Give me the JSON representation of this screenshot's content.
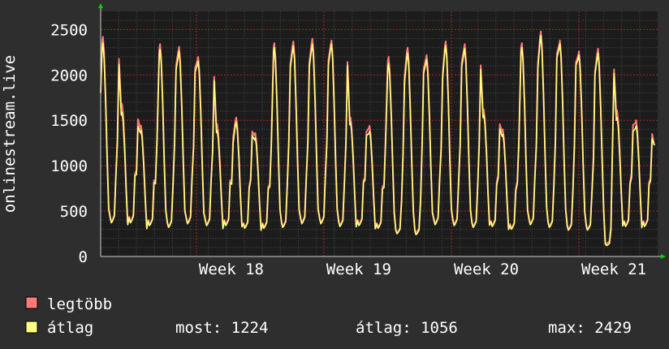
{
  "chart_data": {
    "type": "line",
    "ylabel": "onlinestream.live",
    "ylim": [
      0,
      2700
    ],
    "y_ticks": [
      0,
      500,
      1000,
      1500,
      2000,
      2500
    ],
    "x_ticks": [
      "Week 18",
      "Week 19",
      "Week 20",
      "Week 21"
    ],
    "grid": true,
    "series": [
      {
        "name": "legtöbb",
        "color": "#ff7a7a",
        "peaks": [
          2420,
          1680,
          1440,
          2340,
          2310,
          2200,
          1460,
          1530,
          1360,
          2350,
          2370,
          2400,
          2380,
          1530,
          1440,
          2200,
          2300,
          2220,
          2370,
          2340,
          1620,
          1400,
          2350,
          2480,
          2380,
          2260,
          2290,
          1610,
          1500
        ],
        "troughs": [
          380,
          380,
          350,
          330,
          370,
          350,
          350,
          320,
          320,
          330,
          370,
          370,
          340,
          350,
          320,
          260,
          260,
          360,
          350,
          330,
          340,
          310,
          360,
          330,
          300,
          300,
          140,
          340,
          340
        ]
      },
      {
        "name": "átlag",
        "color": "#ffff80",
        "peaks": [
          2350,
          1590,
          1390,
          2280,
          2260,
          2150,
          1390,
          1480,
          1310,
          2300,
          2320,
          2340,
          2340,
          1480,
          1380,
          2130,
          2240,
          2170,
          2320,
          2290,
          1560,
          1350,
          2300,
          2430,
          2340,
          2220,
          2240,
          1530,
          1440
        ],
        "troughs": [
          370,
          370,
          340,
          320,
          360,
          340,
          340,
          310,
          310,
          320,
          360,
          360,
          330,
          340,
          310,
          250,
          240,
          350,
          340,
          320,
          330,
          300,
          350,
          320,
          290,
          290,
          120,
          330,
          330
        ],
        "last": 1224
      }
    ]
  },
  "legend": {
    "max_label": "legtöbb",
    "avg_label": "átlag",
    "now": "most: 1224",
    "avg": "átlag: 1056",
    "max": "max: 2429"
  },
  "colors": {
    "background": "#2e2e2e",
    "plot": "#1c1c1c",
    "grid_major": "#b02020",
    "grid_minor": "#484848",
    "axis_arrow": "#00d000"
  }
}
